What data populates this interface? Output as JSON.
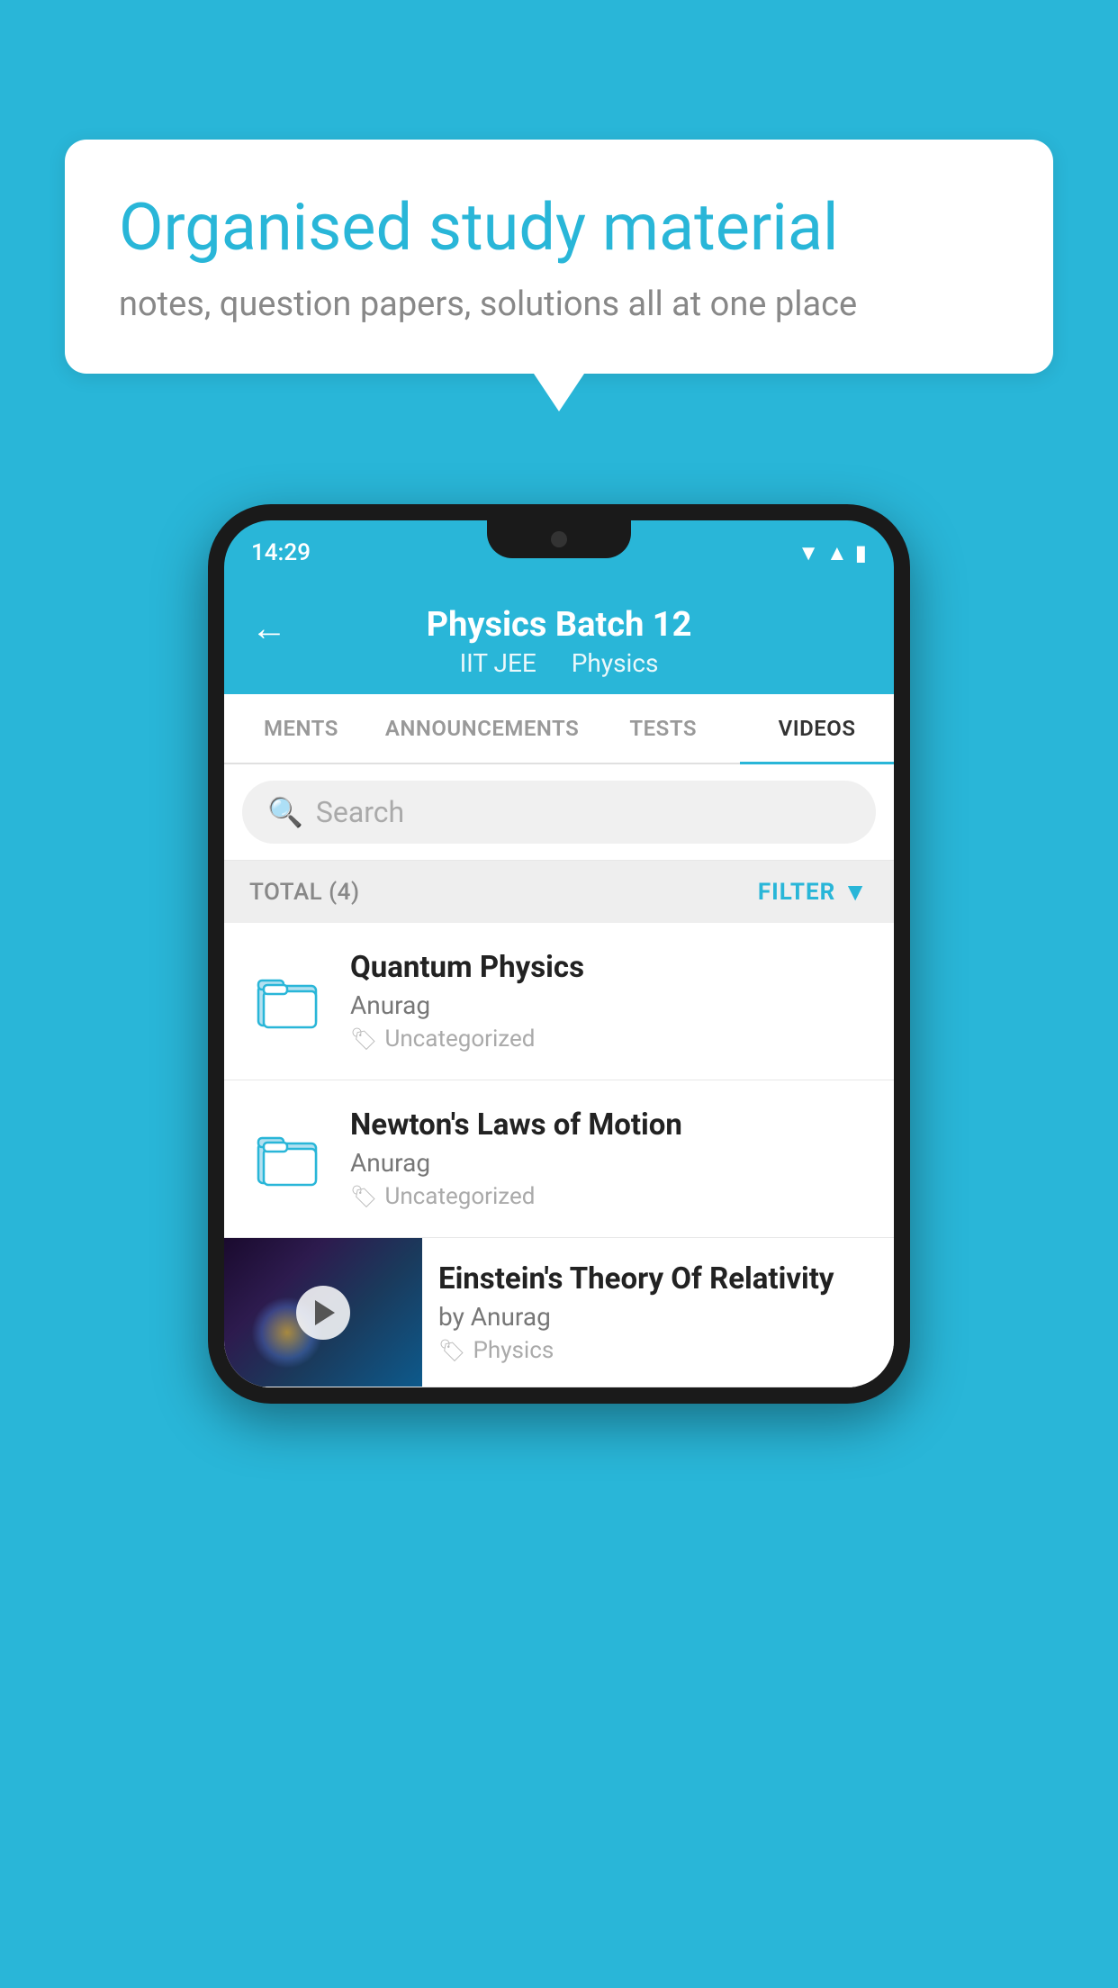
{
  "background_color": "#29b6d8",
  "speech_bubble": {
    "title": "Organised study material",
    "subtitle": "notes, question papers, solutions all at one place"
  },
  "phone": {
    "status_bar": {
      "time": "14:29"
    },
    "app_header": {
      "back_label": "←",
      "title": "Physics Batch 12",
      "subtitle_parts": [
        "IIT JEE",
        "Physics"
      ]
    },
    "tabs": [
      {
        "label": "MENTS",
        "active": false
      },
      {
        "label": "ANNOUNCEMENTS",
        "active": false
      },
      {
        "label": "TESTS",
        "active": false
      },
      {
        "label": "VIDEOS",
        "active": true
      }
    ],
    "search": {
      "placeholder": "Search"
    },
    "filter_bar": {
      "total_label": "TOTAL (4)",
      "filter_label": "FILTER"
    },
    "videos": [
      {
        "id": "quantum",
        "title": "Quantum Physics",
        "author": "Anurag",
        "tag": "Uncategorized",
        "type": "folder"
      },
      {
        "id": "newton",
        "title": "Newton's Laws of Motion",
        "author": "Anurag",
        "tag": "Uncategorized",
        "type": "folder"
      },
      {
        "id": "einstein",
        "title": "Einstein's Theory Of Relativity",
        "author": "by Anurag",
        "tag": "Physics",
        "type": "video"
      }
    ]
  }
}
